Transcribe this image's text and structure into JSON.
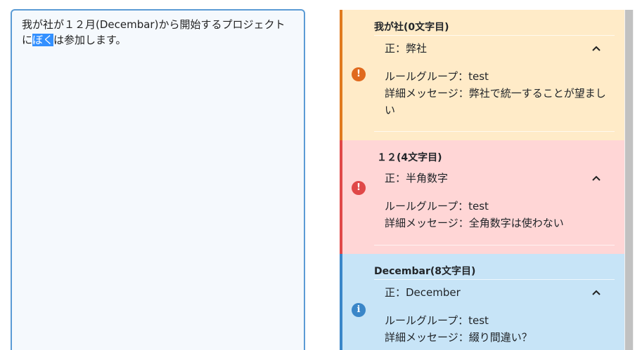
{
  "editor": {
    "text_before": "我が社が１２月(Decembar)から開始するプロジェクトに",
    "text_selected": "ぼく",
    "text_after": "は参加します。"
  },
  "results": [
    {
      "level": "warning",
      "icon": "exclamation-circle-icon",
      "color": "#e07a1f",
      "title": "我が社(0文字目)",
      "correct": "正：弊社",
      "rule_group": "ルールグループ：test",
      "message": "詳細メッセージ：弊社で統一することが望ましい"
    },
    {
      "level": "error",
      "icon": "exclamation-circle-icon",
      "color": "#e04848",
      "title": "１２(4文字目)",
      "correct": "正：半角数字",
      "rule_group": "ルールグループ：test",
      "message": "詳細メッセージ：全角数字は使わない"
    },
    {
      "level": "info",
      "icon": "info-circle-icon",
      "color": "#3a86c8",
      "title": "Decembar(8文字目)",
      "correct": "正：December",
      "rule_group": "ルールグループ：test",
      "message": "詳細メッセージ：綴り間違い？"
    }
  ]
}
